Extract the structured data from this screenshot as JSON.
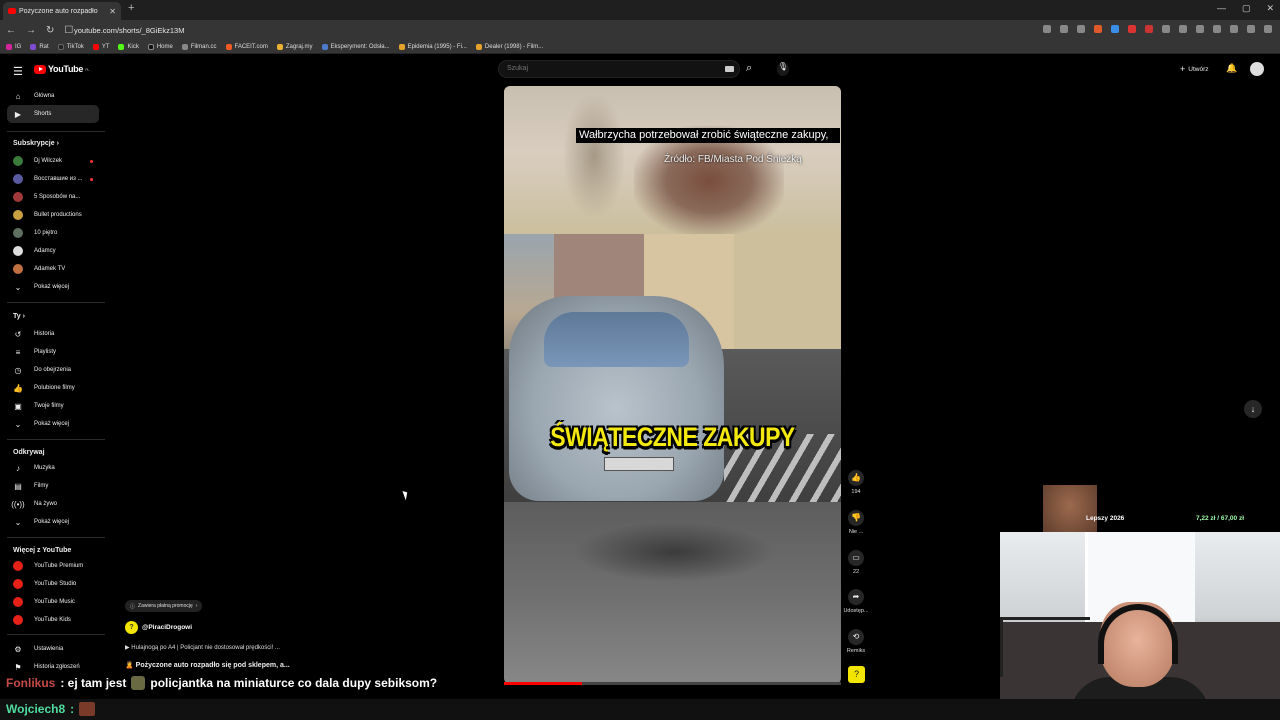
{
  "browser": {
    "tab_title": "Pożyczone auto rozpadło",
    "url": "youtube.com/shorts/_8GiEkz13M",
    "bookmarks": [
      "IG",
      "Rat",
      "TikTok",
      "YT",
      "Kick",
      "Home",
      "Filman.cc",
      "FACEIT.com",
      "Zagraj.my",
      "Eksperyment: Odsła...",
      "Epidemia (1995) - Fi...",
      "Dealer (1998) - Film..."
    ]
  },
  "header": {
    "logo": "YouTube",
    "logo_sup": "PL",
    "search_placeholder": "Szukaj",
    "create_label": "Utwórz"
  },
  "sidebar": {
    "main": [
      {
        "label": "Główna",
        "icon": "home-icon"
      },
      {
        "label": "Shorts",
        "icon": "shorts-icon"
      }
    ],
    "subs_title": "Subskrypcje",
    "subs": [
      {
        "label": "Dj Wilczek",
        "color": "#3a7a3a",
        "live": true
      },
      {
        "label": "Восставшие из ...",
        "color": "#5a5aa0",
        "live": true
      },
      {
        "label": "5 Sposobów na...",
        "color": "#a03a3a",
        "live": false
      },
      {
        "label": "Bullet productions",
        "color": "#c8a040",
        "live": false
      },
      {
        "label": "10 piętro",
        "color": "#607060",
        "live": false
      },
      {
        "label": "Adamcy",
        "color": "#dddddd",
        "live": false
      },
      {
        "label": "Adamek TV",
        "color": "#c07040",
        "live": false
      }
    ],
    "show_more": "Pokaż więcej",
    "you_title": "Ty",
    "you": [
      {
        "label": "Historia",
        "icon": "history-icon"
      },
      {
        "label": "Playlisty",
        "icon": "playlist-icon"
      },
      {
        "label": "Do obejrzenia",
        "icon": "clock-icon"
      },
      {
        "label": "Polubione filmy",
        "icon": "thumbs-up-icon"
      },
      {
        "label": "Twoje filmy",
        "icon": "video-icon"
      }
    ],
    "explore_title": "Odkrywaj",
    "explore": [
      {
        "label": "Muzyka",
        "icon": "music-icon"
      },
      {
        "label": "Filmy",
        "icon": "film-icon"
      },
      {
        "label": "Na żywo",
        "icon": "live-icon"
      }
    ],
    "more_title": "Więcej z YouTube",
    "more": [
      {
        "label": "YouTube Premium"
      },
      {
        "label": "YouTube Studio"
      },
      {
        "label": "YouTube Music"
      },
      {
        "label": "YouTube Kids"
      }
    ],
    "settings": "Ustawienia",
    "report_history": "Historia zgłoszeń"
  },
  "video": {
    "caption": "Wałbrzycha potrzebował zrobić świąteczne zakupy,",
    "source": "Źródło: FB/Miasta Pod Śnieżką",
    "big_text": "ŚWIĄTECZNE ZAKUPY",
    "progress": 0.23
  },
  "actions": {
    "likes": "194",
    "dislike": "Nie ...",
    "comments": "22",
    "share": "Udostęp...",
    "remix": "Remiks"
  },
  "overlay": {
    "promo": "Zawiera płatną promocję",
    "channel": "@PiraciDrogowi",
    "desc1": "Hulajnogą po A4 | Policjant nie dostosował prędkości! ...",
    "desc2": "Pożyczone auto rozpadło się pod sklepem, a..."
  },
  "chat": {
    "user1": "Fonlikus",
    "msg1a": ": ej tam jest",
    "msg1b": "policjantka na miniaturce co dala dupy sebiksom?",
    "user2": "Wojciech8",
    "msg2": ":"
  },
  "stream": {
    "goal_label": "Lepszy 2026",
    "goal_amount": "7,22 zł / 67,00 zł"
  }
}
